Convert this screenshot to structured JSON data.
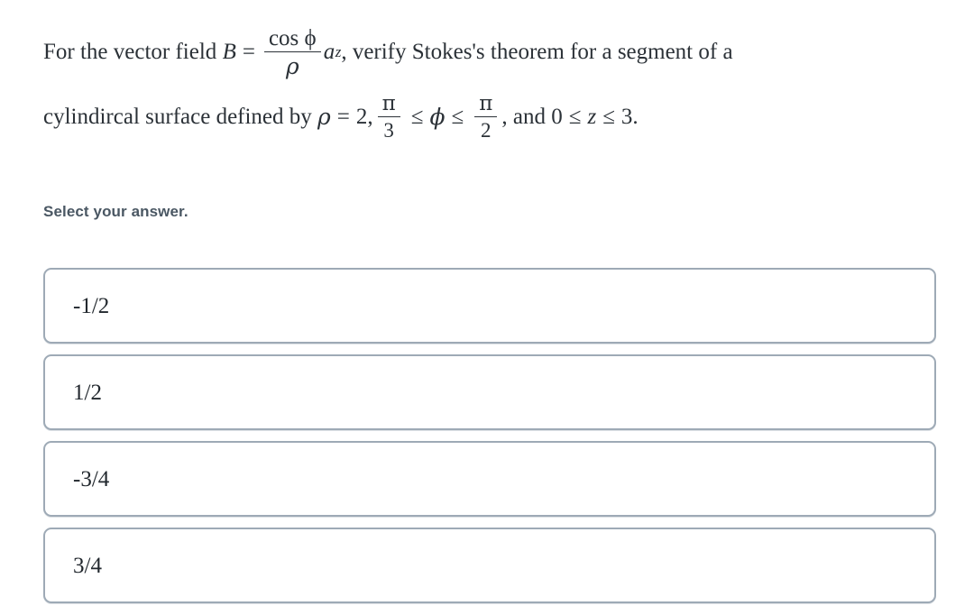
{
  "question": {
    "line1": {
      "lead": "For the vector field ",
      "var_b": "B",
      "equals": "=",
      "frac_numerator": "cos ϕ",
      "frac_denominator": "ρ",
      "unit_vector_base": "a",
      "unit_vector_sub": "z",
      "after": ", verify Stokes's theorem for a segment of a"
    },
    "line2": {
      "lead": "cylindircal surface defined by ",
      "rho": "ρ",
      "equals": "=",
      "rho_value": "2,",
      "frac1_numerator": "π",
      "frac1_denominator": "3",
      "le1": "≤",
      "phi": "ϕ",
      "le2": "≤",
      "frac2_numerator": "π",
      "frac2_denominator": "2",
      "comma_and": ", and ",
      "z_lower": "0",
      "le3": "≤",
      "z_var": "z",
      "le4": "≤",
      "z_upper": "3."
    },
    "plain_text": "For the vector field B = (cos ϕ)/ρ a_z, verify Stokes's theorem for a segment of a cylindircal surface defined by ρ = 2, π/3 ≤ ϕ ≤ π/2, and 0 ≤ z ≤ 3."
  },
  "prompt": {
    "select_label": "Select your answer."
  },
  "options": [
    {
      "label": "-1/2"
    },
    {
      "label": "1/2"
    },
    {
      "label": "-3/4"
    },
    {
      "label": "3/4"
    }
  ],
  "colors": {
    "background": "#ffffff",
    "body_text": "#2b3137",
    "label_text": "#4a5763",
    "option_border": "#9eaab6",
    "option_text": "#22282e"
  }
}
